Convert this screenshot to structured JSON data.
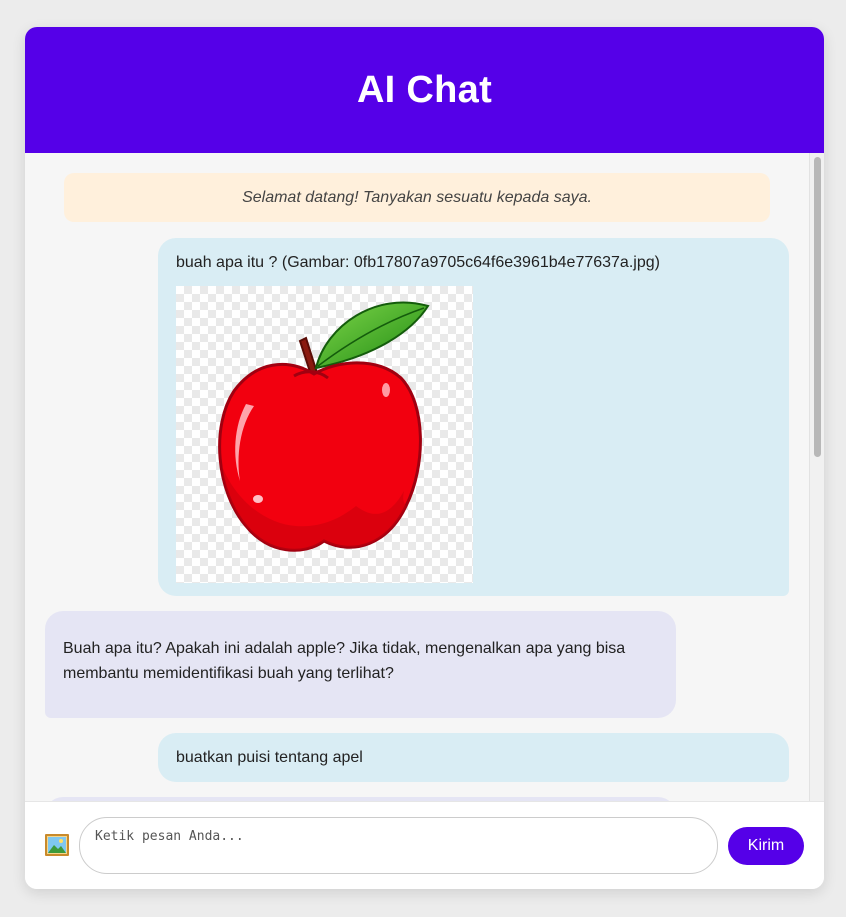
{
  "header": {
    "title": "AI Chat"
  },
  "chat": {
    "welcome": "Selamat datang! Tanyakan sesuatu kepada saya.",
    "messages": [
      {
        "role": "user",
        "text": "buah apa itu ? (Gambar: 0fb17807a9705c64f6e3961b4e77637a.jpg)",
        "image": "red-apple"
      },
      {
        "role": "ai",
        "text": "Buah apa itu? Apakah ini adalah apple? Jika tidak, mengenalkan apa yang bisa membantu memidentifikasi buah yang terlihat?"
      },
      {
        "role": "user",
        "text": "buatkan puisi tentang apel"
      },
      {
        "role": "ai",
        "text": ""
      }
    ]
  },
  "composer": {
    "image_icon": "picture-icon",
    "placeholder": "Ketik pesan Anda...",
    "value": "",
    "send_label": "Kirim"
  },
  "colors": {
    "accent": "#5500e8",
    "user_bubble": "#d9edf4",
    "ai_bubble": "#e5e5f4",
    "welcome_bg": "#fff0dc"
  }
}
